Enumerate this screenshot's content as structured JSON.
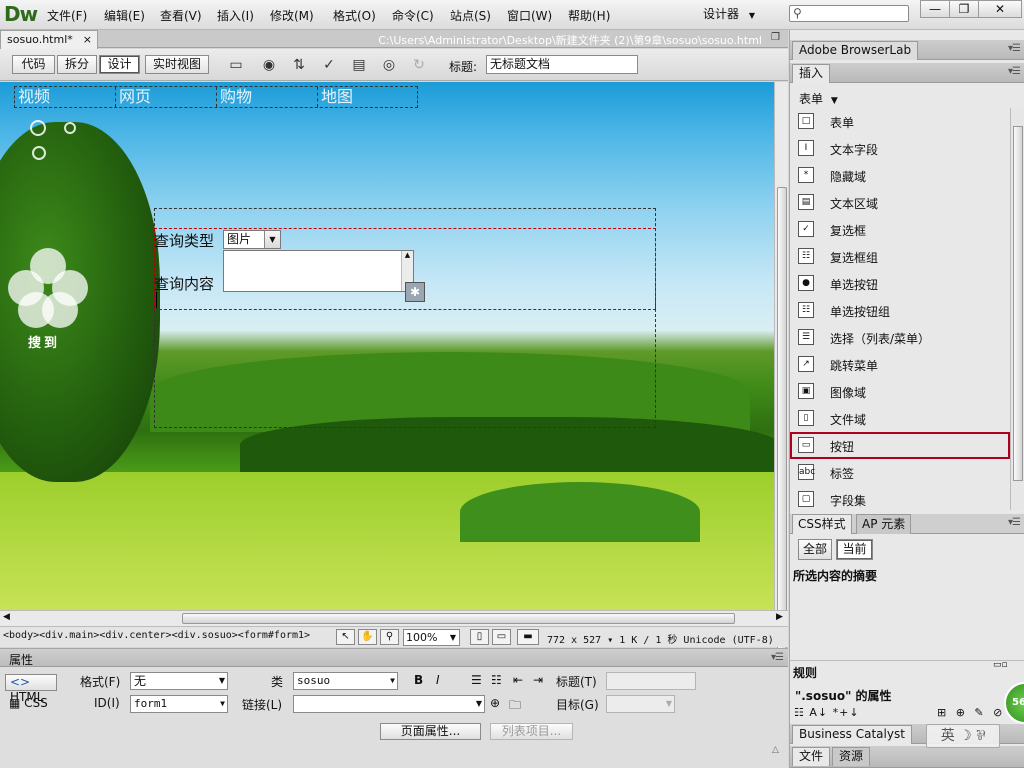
{
  "app": {
    "logo": "Dw"
  },
  "menu": [
    "文件(F)",
    "编辑(E)",
    "查看(V)",
    "插入(I)",
    "修改(M)",
    "格式(O)",
    "命令(C)",
    "站点(S)",
    "窗口(W)",
    "帮助(H)"
  ],
  "workspace": {
    "label": "设计器"
  },
  "window_controls": {
    "minimize": "—",
    "restore": "❐",
    "close": "✕"
  },
  "document": {
    "tab": "sosuo.html*",
    "close": "×",
    "path": "C:\\Users\\Administrator\\Desktop\\新建文件夹 (2)\\第9章\\sosuo\\sosuo.html"
  },
  "toolbar": {
    "views": [
      "代码",
      "拆分",
      "设计",
      "实时视图"
    ],
    "active_view": "设计",
    "title_label": "标题:",
    "title_value": "无标题文档"
  },
  "canvas": {
    "nav": [
      "视频",
      "网页",
      "购物",
      "地图"
    ],
    "brand": "搜到",
    "form": {
      "type_label": "查询类型",
      "type_value": "图片",
      "content_label": "查询内容"
    }
  },
  "statusbar": {
    "tag_path": "<body><div.main><div.center><div.sosuo><form#form1>",
    "zoom": "100%",
    "window_size": "772 x 527 ▾ 1 K / 1 秒 Unicode (UTF-8)"
  },
  "properties": {
    "title": "属性",
    "html_btn": "HTML",
    "css_btn": "CSS",
    "format_label": "格式(F)",
    "format_value": "无",
    "class_label": "类",
    "class_value": "sosuo",
    "id_label": "ID(I)",
    "id_value": "form1",
    "link_label": "链接(L)",
    "title_label": "标题(T)",
    "target_label": "目标(G)",
    "page_props_btn": "页面属性...",
    "list_item_btn": "列表项目..."
  },
  "right": {
    "browserlab": "Adobe BrowserLab",
    "insert_tab": "插入",
    "category": "表单",
    "items": [
      {
        "label": "表单",
        "icon": "form-icon"
      },
      {
        "label": "文本字段",
        "icon": "text-field-icon"
      },
      {
        "label": "隐藏域",
        "icon": "hidden-field-icon"
      },
      {
        "label": "文本区域",
        "icon": "textarea-icon"
      },
      {
        "label": "复选框",
        "icon": "checkbox-icon"
      },
      {
        "label": "复选框组",
        "icon": "checkbox-group-icon"
      },
      {
        "label": "单选按钮",
        "icon": "radio-icon"
      },
      {
        "label": "单选按钮组",
        "icon": "radio-group-icon"
      },
      {
        "label": "选择（列表/菜单）",
        "icon": "select-icon"
      },
      {
        "label": "跳转菜单",
        "icon": "jump-menu-icon"
      },
      {
        "label": "图像域",
        "icon": "image-field-icon"
      },
      {
        "label": "文件域",
        "icon": "file-field-icon"
      },
      {
        "label": "按钮",
        "icon": "button-icon",
        "selected": true
      },
      {
        "label": "标签",
        "icon": "label-icon"
      },
      {
        "label": "字段集",
        "icon": "fieldset-icon"
      }
    ],
    "css_tab": "CSS样式",
    "ap_tab": "AP 元素",
    "seg_all": "全部",
    "seg_current": "当前",
    "summary": "所选内容的摘要",
    "rules": "规则",
    "props_of": "\".sosuo\" 的属性",
    "bc_tab": "Business Catalyst",
    "files_tab": "文件",
    "assets_tab": "资源",
    "badge": "56",
    "ime": "英 ☽ ⅌"
  }
}
